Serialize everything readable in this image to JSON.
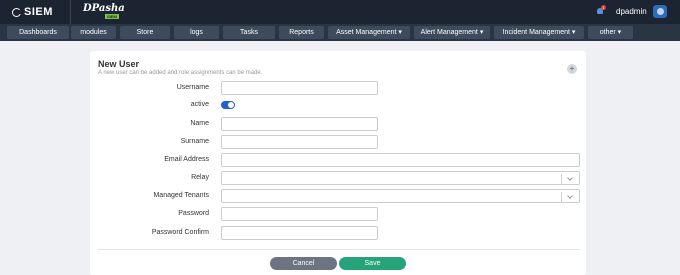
{
  "header": {
    "brand": "SIEM",
    "product_logo": "DPasha",
    "product_sub": "SIEM",
    "notification_count": "1",
    "username": "dpadmin"
  },
  "nav": {
    "items": [
      {
        "label": "Dashboards"
      },
      {
        "label": "modules"
      },
      {
        "label": "Store"
      },
      {
        "label": "logs"
      },
      {
        "label": "Tasks"
      },
      {
        "label": "Reports"
      },
      {
        "label": "Asset Management ▾"
      },
      {
        "label": "Alert Management ▾"
      },
      {
        "label": "Incident Management ▾"
      },
      {
        "label": "other ▾"
      }
    ]
  },
  "form": {
    "title": "New User",
    "subtitle": "A new user can be added and role assignments can be made.",
    "plus_icon": "+",
    "fields": {
      "username": {
        "label": "Username",
        "value": ""
      },
      "active": {
        "label": "active",
        "checked": true
      },
      "name": {
        "label": "Name",
        "value": ""
      },
      "surname": {
        "label": "Surname",
        "value": ""
      },
      "email": {
        "label": "Email Address",
        "value": ""
      },
      "relay": {
        "label": "Relay",
        "value": ""
      },
      "tenants": {
        "label": "Managed Tenants",
        "value": ""
      },
      "password": {
        "label": "Password",
        "value": ""
      },
      "password_confirm": {
        "label": "Password Confirm",
        "value": ""
      }
    },
    "cancel_label": "Cancel",
    "save_label": "Save"
  },
  "colors": {
    "topbar": "#1b2430",
    "navbar": "#2a3543",
    "toggle_on": "#1e62d0",
    "save": "#27a37a",
    "cancel": "#6b7480"
  }
}
